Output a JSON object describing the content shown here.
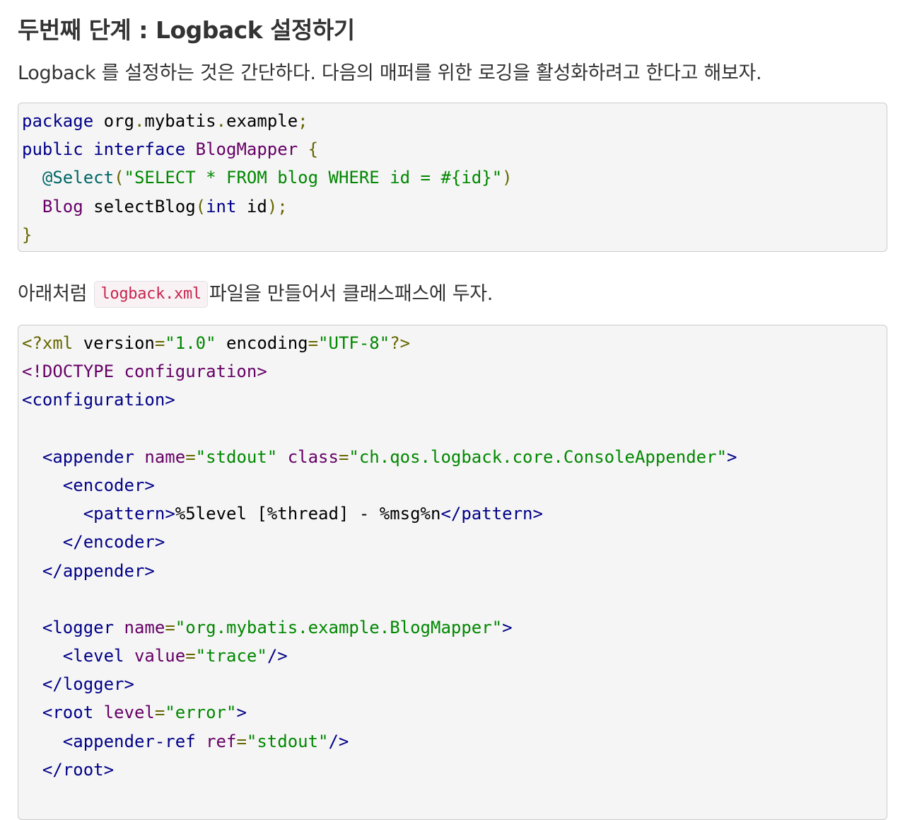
{
  "section": {
    "title": "두번째 단계 : Logback 설정하기"
  },
  "intro": {
    "text": "Logback 를 설정하는 것은 간단하다. 다음의 매퍼를 위한 로깅을 활성화하려고 한다고 해보자."
  },
  "java_code": {
    "lines": [
      [
        "package",
        " org",
        ".",
        "mybatis",
        ".",
        "example",
        ";"
      ],
      [
        "public",
        " ",
        "interface",
        " ",
        "BlogMapper",
        " ",
        "{"
      ],
      [
        "  ",
        "@Select",
        "(",
        "\"SELECT * FROM blog WHERE id = #{id}\"",
        ")"
      ],
      [
        "  ",
        "Blog",
        " selectBlog",
        "(",
        "int",
        " id",
        ");"
      ],
      [
        "}"
      ]
    ]
  },
  "instruction": {
    "before": "아래처럼 ",
    "filename": "logback.xml",
    "after": "파일을 만들어서 클래스패스에 두자."
  },
  "xml_code": {
    "decl_open": "<?xml",
    "decl_version_attr": " version",
    "decl_version_val": "\"1.0\"",
    "decl_encoding_attr": " encoding",
    "decl_encoding_val": "\"UTF-8\"",
    "decl_close": "?>",
    "doctype": "<!DOCTYPE configuration>",
    "configuration_open": "configuration",
    "appender_tag": "appender",
    "appender_name_attr": " name",
    "appender_name_val": "\"stdout\"",
    "appender_class_attr": " class",
    "appender_class_val": "\"ch.qos.logback.core.ConsoleAppender\"",
    "encoder_tag": "encoder",
    "pattern_tag": "pattern",
    "pattern_value": "%5level [%thread] - %msg%n",
    "logger_tag": "logger",
    "logger_name_attr": " name",
    "logger_name_val": "\"org.mybatis.example.BlogMapper\"",
    "level_tag": "level",
    "level_value_attr": " value",
    "level_value_val": "\"trace\"",
    "root_tag": "root",
    "root_level_attr": " level",
    "root_level_val": "\"error\"",
    "appender_ref_tag": "appender-ref",
    "appender_ref_attr": " ref",
    "appender_ref_val": "\"stdout\""
  }
}
